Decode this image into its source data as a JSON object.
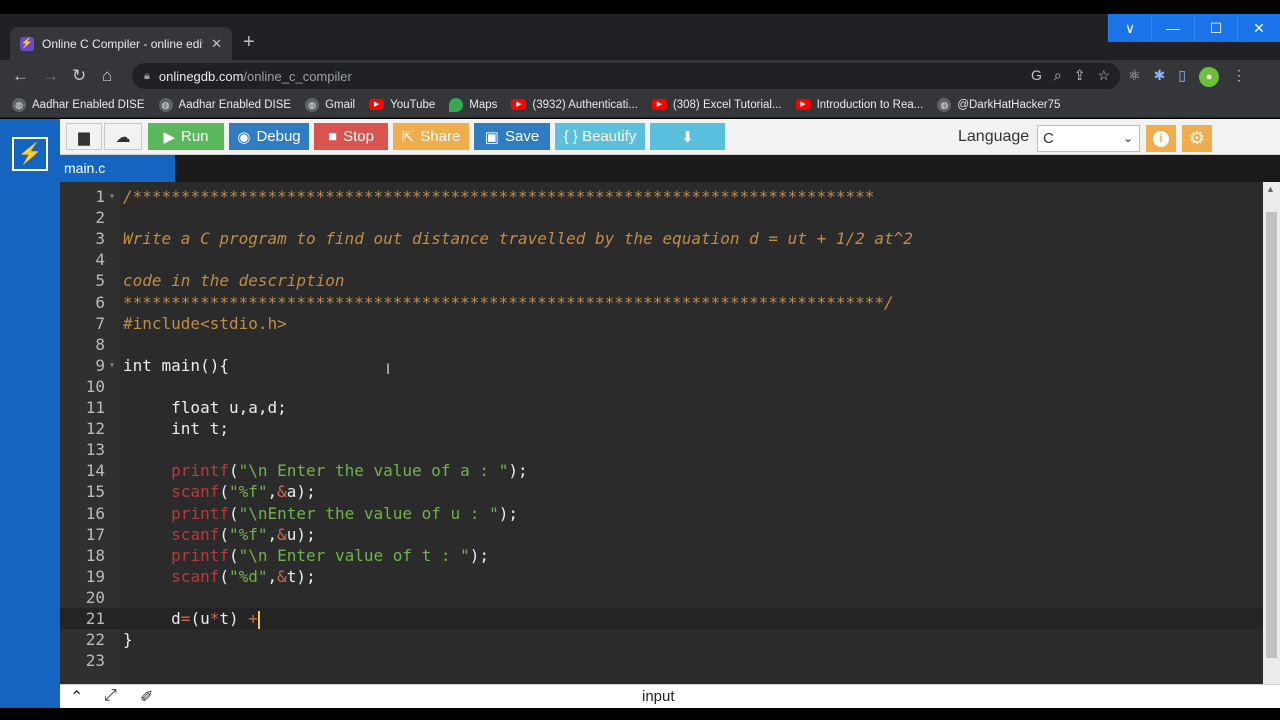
{
  "browser": {
    "tab_title": "Online C Compiler - online editor",
    "new_tab_symbol": "+",
    "url_host": "onlinegdb.com",
    "url_path": "/online_c_compiler",
    "window_controls": [
      "∨",
      "—",
      "☐",
      "✕"
    ],
    "bookmarks": [
      {
        "label": "Aadhar Enabled DISE",
        "icon": "globe-icon"
      },
      {
        "label": "Aadhar Enabled DISE",
        "icon": "globe-icon"
      },
      {
        "label": "Gmail",
        "icon": "globe-icon"
      },
      {
        "label": "YouTube",
        "icon": "youtube-icon"
      },
      {
        "label": "Maps",
        "icon": "maps-icon"
      },
      {
        "label": "(3932) Authenticati...",
        "icon": "youtube-icon"
      },
      {
        "label": "(308) Excel Tutorial...",
        "icon": "youtube-icon"
      },
      {
        "label": "Introduction to Rea...",
        "icon": "youtube-icon"
      },
      {
        "label": "@DarkHatHacker75",
        "icon": "globe-icon"
      }
    ]
  },
  "toolbar": {
    "run": "Run",
    "debug": "Debug",
    "stop": "Stop",
    "share": "Share",
    "save": "Save",
    "beautify": "{ } Beautify",
    "language_label": "Language",
    "language_value": "C",
    "colors": {
      "run": "#5cb85c",
      "debug": "#2f7dc0",
      "stop": "#d9534f",
      "share": "#f0ad4e",
      "save": "#2f7dc0",
      "beautify": "#5bc0de",
      "download": "#5bc0de"
    }
  },
  "file_tab": "main.c",
  "editor": {
    "lines": [
      {
        "n": "1",
        "fold": "▾",
        "html": "<span class='tok-cmt'>/*****************************************************************************</span>"
      },
      {
        "n": "2",
        "fold": "",
        "html": ""
      },
      {
        "n": "3",
        "fold": "",
        "html": "<span class='tok-cmt'>Write a C program to find out distance travelled by the equation d = ut + 1/2 at^2</span>"
      },
      {
        "n": "4",
        "fold": "",
        "html": ""
      },
      {
        "n": "5",
        "fold": "",
        "html": "<span class='tok-cmt'>code in the description</span>"
      },
      {
        "n": "6",
        "fold": "",
        "html": "<span class='tok-cmt'>*******************************************************************************/</span>"
      },
      {
        "n": "7",
        "fold": "",
        "html": "<span class='tok-pp'>#include&lt;stdio.h&gt;</span>"
      },
      {
        "n": "8",
        "fold": "",
        "html": ""
      },
      {
        "n": "9",
        "fold": "▾",
        "html": "int main(){"
      },
      {
        "n": "10",
        "fold": "",
        "html": ""
      },
      {
        "n": "11",
        "fold": "",
        "html": "     float u,a,d;"
      },
      {
        "n": "12",
        "fold": "",
        "html": "     int t;"
      },
      {
        "n": "13",
        "fold": "",
        "html": ""
      },
      {
        "n": "14",
        "fold": "",
        "html": "     <span class='tok-fn'>printf</span>(<span class='tok-str'>\"\\n Enter the value of a : \"</span>);"
      },
      {
        "n": "15",
        "fold": "",
        "html": "     <span class='tok-fn'>scanf</span>(<span class='tok-str'>\"%f\"</span>,<span class='tok-op'>&amp;</span>a);"
      },
      {
        "n": "16",
        "fold": "",
        "html": "     <span class='tok-fn'>printf</span>(<span class='tok-str'>\"\\nEnter the value of u : \"</span>);"
      },
      {
        "n": "17",
        "fold": "",
        "html": "     <span class='tok-fn'>scanf</span>(<span class='tok-str'>\"%f\"</span>,<span class='tok-op'>&amp;</span>u);"
      },
      {
        "n": "18",
        "fold": "",
        "html": "     <span class='tok-fn'>printf</span>(<span class='tok-str'>\"\\n Enter value of t : \"</span>);"
      },
      {
        "n": "19",
        "fold": "",
        "html": "     <span class='tok-fn'>scanf</span>(<span class='tok-str'>\"%d\"</span>,<span class='tok-op'>&amp;</span>t);"
      },
      {
        "n": "20",
        "fold": "",
        "html": ""
      },
      {
        "n": "21",
        "fold": "",
        "html": "     d<span class='tok-op'>=</span>(u<span class='tok-op'>*</span>t) <span class='tok-op'>+</span><span class='cursor'></span>",
        "active": true
      },
      {
        "n": "22",
        "fold": "",
        "html": "}"
      },
      {
        "n": "23",
        "fold": "",
        "html": ""
      }
    ]
  },
  "bottom_bar": {
    "input_label": "input"
  }
}
